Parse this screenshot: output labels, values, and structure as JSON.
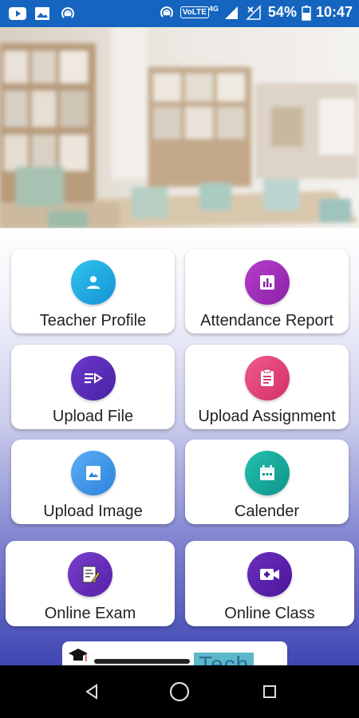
{
  "status_bar": {
    "battery_percent": "54%",
    "time": "10:47",
    "volte_label": "VoLTE",
    "network_label": "4G",
    "left_icons": [
      "youtube-icon",
      "gallery-icon",
      "hotspot-icon"
    ],
    "right_icons": [
      "hotspot-icon",
      "volte-icon",
      "signal-icon",
      "no-signal-icon",
      "battery-icon"
    ]
  },
  "hero": {
    "description_icon": "classroom-photo"
  },
  "menu": {
    "items": [
      {
        "label": "Teacher Profile",
        "icon": "person-icon",
        "color": "#1fa8e0"
      },
      {
        "label": "Attendance Report",
        "icon": "bar-chart-icon",
        "color": "#9b2fb4"
      },
      {
        "label": "Upload File",
        "icon": "video-upload-icon",
        "color": "#5a2bb8"
      },
      {
        "label": "Upload Assignment",
        "icon": "clipboard-icon",
        "color": "#e8407a"
      },
      {
        "label": "Upload Image",
        "icon": "image-icon",
        "color": "#3f9ae8"
      },
      {
        "label": "Calender",
        "icon": "calendar-icon",
        "color": "#17a99b"
      },
      {
        "label": "Online Exam",
        "icon": "exam-icon",
        "color": "#6a2bb5"
      },
      {
        "label": "Online Class",
        "icon": "video-call-icon",
        "color": "#5a1fa8"
      }
    ]
  },
  "footer_logo": {
    "text": "Tech",
    "icon": "graduation-cap-icon"
  },
  "nav_bar": {
    "buttons": [
      "back-icon",
      "home-icon",
      "recents-icon"
    ]
  }
}
